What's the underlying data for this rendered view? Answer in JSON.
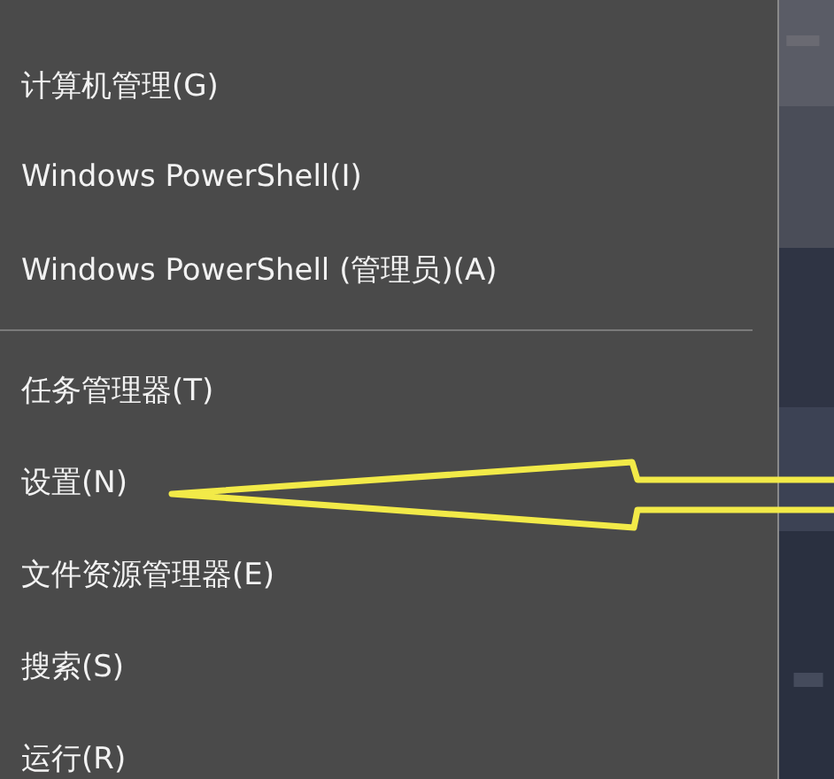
{
  "menu": {
    "groups": [
      {
        "items": [
          {
            "label": "计算机管理(G)"
          },
          {
            "label": "Windows PowerShell(I)"
          },
          {
            "label": "Windows PowerShell (管理员)(A)"
          }
        ]
      },
      {
        "items": [
          {
            "label": "任务管理器(T)"
          },
          {
            "label": "设置(N)"
          },
          {
            "label": "文件资源管理器(E)"
          },
          {
            "label": "搜索(S)"
          },
          {
            "label": "运行(R)"
          }
        ]
      }
    ]
  },
  "annotation": {
    "kind": "arrow"
  }
}
